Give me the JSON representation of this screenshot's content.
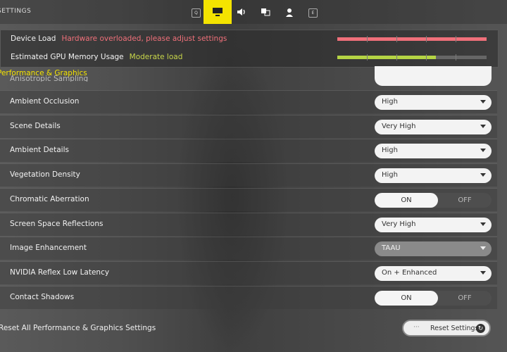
{
  "header": {
    "title": "SETTINGS",
    "left_key": "Q",
    "right_key": "E",
    "tabs": [
      {
        "icon": "monitor-icon",
        "active": true
      },
      {
        "icon": "speaker-icon",
        "active": false
      },
      {
        "icon": "language-icon",
        "active": false
      },
      {
        "icon": "user-icon",
        "active": false
      }
    ]
  },
  "device_load": {
    "label": "Device Load",
    "status": "Hardware overloaded, please adjust settings",
    "level_percent": 100,
    "color": "#f0707a"
  },
  "gpu_memory": {
    "label": "Estimated GPU Memory Usage",
    "status": "Moderate load",
    "level_percent": 66,
    "color": "#b5d444"
  },
  "section_title": "Performance & Graphics",
  "partial_row": {
    "label": "Anisotropic Sampling"
  },
  "settings": [
    {
      "label": "Ambient Occlusion",
      "type": "dropdown",
      "value": "High"
    },
    {
      "label": "Scene Details",
      "type": "dropdown",
      "value": "Very High"
    },
    {
      "label": "Ambient Details",
      "type": "dropdown",
      "value": "High"
    },
    {
      "label": "Vegetation Density",
      "type": "dropdown",
      "value": "High"
    },
    {
      "label": "Chromatic Aberration",
      "type": "toggle",
      "on_label": "ON",
      "off_label": "OFF",
      "value": "ON"
    },
    {
      "label": "Screen Space Reflections",
      "type": "dropdown",
      "value": "Very High"
    },
    {
      "label": "Image Enhancement",
      "type": "dropdown",
      "value": "TAAU",
      "disabled": true
    },
    {
      "label": "NVIDIA Reflex Low Latency",
      "type": "dropdown",
      "value": "On + Enhanced"
    },
    {
      "label": "Contact Shadows",
      "type": "toggle",
      "on_label": "ON",
      "off_label": "OFF",
      "value": "ON"
    }
  ],
  "reset": {
    "label": "Reset All Performance & Graphics Settings",
    "button": "Reset Settings",
    "hint": "···"
  },
  "colors": {
    "accent": "#f4e300"
  }
}
